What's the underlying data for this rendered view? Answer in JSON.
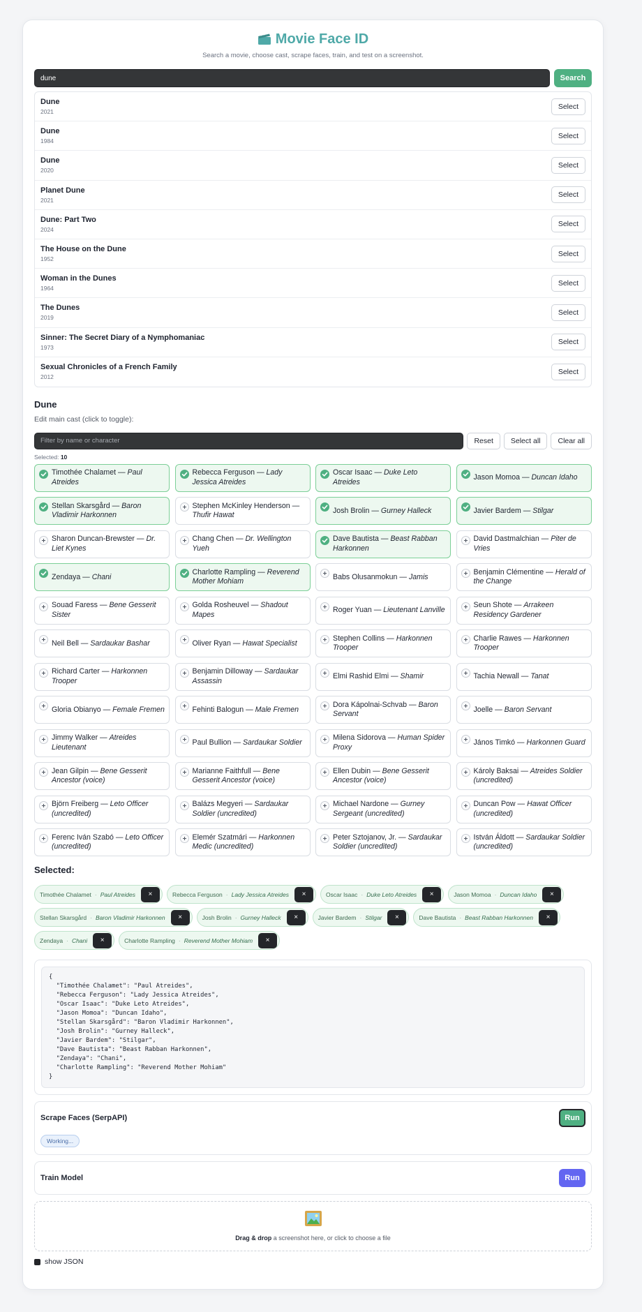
{
  "header": {
    "title": "Movie Face ID",
    "subtitle": "Search a movie, choose cast, scrape faces, train, and test on a screenshot."
  },
  "search": {
    "value": "dune",
    "button": "Search"
  },
  "results": [
    {
      "title": "Dune",
      "year": "2021"
    },
    {
      "title": "Dune",
      "year": "1984"
    },
    {
      "title": "Dune",
      "year": "2020"
    },
    {
      "title": "Planet Dune",
      "year": "2021"
    },
    {
      "title": "Dune: Part Two",
      "year": "2024"
    },
    {
      "title": "The House on the Dune",
      "year": "1952"
    },
    {
      "title": "Woman in the Dunes",
      "year": "1964"
    },
    {
      "title": "The Dunes",
      "year": "2019"
    },
    {
      "title": "Sinner: The Secret Diary of a Nymphomaniac",
      "year": "1973"
    },
    {
      "title": "Sexual Chronicles of a French Family",
      "year": "2012"
    }
  ],
  "select_label": "Select",
  "movie": {
    "title": "Dune",
    "edit_label": "Edit main cast (click to toggle):",
    "filter_placeholder": "Filter by name or character",
    "reset": "Reset",
    "select_all": "Select all",
    "clear_all": "Clear all",
    "selected_label": "Selected:",
    "selected_count": "10"
  },
  "cast": [
    {
      "actor": "Timothée Chalamet",
      "role": "Paul Atreides",
      "selected": true
    },
    {
      "actor": "Rebecca Ferguson",
      "role": "Lady Jessica Atreides",
      "selected": true
    },
    {
      "actor": "Oscar Isaac",
      "role": "Duke Leto Atreides",
      "selected": true
    },
    {
      "actor": "Jason Momoa",
      "role": "Duncan Idaho",
      "selected": true
    },
    {
      "actor": "Stellan Skarsgård",
      "role": "Baron Vladimir Harkonnen",
      "selected": true
    },
    {
      "actor": "Stephen McKinley Henderson",
      "role": "Thufir Hawat",
      "selected": false
    },
    {
      "actor": "Josh Brolin",
      "role": "Gurney Halleck",
      "selected": true
    },
    {
      "actor": "Javier Bardem",
      "role": "Stilgar",
      "selected": true
    },
    {
      "actor": "Sharon Duncan-Brewster",
      "role": "Dr. Liet Kynes",
      "selected": false
    },
    {
      "actor": "Chang Chen",
      "role": "Dr. Wellington Yueh",
      "selected": false
    },
    {
      "actor": "Dave Bautista",
      "role": "Beast Rabban Harkonnen",
      "selected": true
    },
    {
      "actor": "David Dastmalchian",
      "role": "Piter de Vries",
      "selected": false
    },
    {
      "actor": "Zendaya",
      "role": "Chani",
      "selected": true
    },
    {
      "actor": "Charlotte Rampling",
      "role": "Reverend Mother Mohiam",
      "selected": true
    },
    {
      "actor": "Babs Olusanmokun",
      "role": "Jamis",
      "selected": false
    },
    {
      "actor": "Benjamin Clémentine",
      "role": "Herald of the Change",
      "selected": false
    },
    {
      "actor": "Souad Faress",
      "role": "Bene Gesserit Sister",
      "selected": false
    },
    {
      "actor": "Golda Rosheuvel",
      "role": "Shadout Mapes",
      "selected": false
    },
    {
      "actor": "Roger Yuan",
      "role": "Lieutenant Lanville",
      "selected": false
    },
    {
      "actor": "Seun Shote",
      "role": "Arrakeen Residency Gardener",
      "selected": false
    },
    {
      "actor": "Neil Bell",
      "role": "Sardaukar Bashar",
      "selected": false
    },
    {
      "actor": "Oliver Ryan",
      "role": "Hawat Specialist",
      "selected": false
    },
    {
      "actor": "Stephen Collins",
      "role": "Harkonnen Trooper",
      "selected": false
    },
    {
      "actor": "Charlie Rawes",
      "role": "Harkonnen Trooper",
      "selected": false
    },
    {
      "actor": "Richard Carter",
      "role": "Harkonnen Trooper",
      "selected": false
    },
    {
      "actor": "Benjamin Dilloway",
      "role": "Sardaukar Assassin",
      "selected": false
    },
    {
      "actor": "Elmi Rashid Elmi",
      "role": "Shamir",
      "selected": false
    },
    {
      "actor": "Tachia Newall",
      "role": "Tanat",
      "selected": false
    },
    {
      "actor": "Gloria Obianyo",
      "role": "Female Fremen",
      "selected": false
    },
    {
      "actor": "Fehinti Balogun",
      "role": "Male Fremen",
      "selected": false
    },
    {
      "actor": "Dora Kápolnai-Schvab",
      "role": "Baron Servant",
      "selected": false
    },
    {
      "actor": "Joelle",
      "role": "Baron Servant",
      "selected": false
    },
    {
      "actor": "Jimmy Walker",
      "role": "Atreides Lieutenant",
      "selected": false
    },
    {
      "actor": "Paul Bullion",
      "role": "Sardaukar Soldier",
      "selected": false
    },
    {
      "actor": "Milena Sidorova",
      "role": "Human Spider Proxy",
      "selected": false
    },
    {
      "actor": "János Timkó",
      "role": "Harkonnen Guard",
      "selected": false
    },
    {
      "actor": "Jean Gilpin",
      "role": "Bene Gesserit Ancestor (voice)",
      "selected": false
    },
    {
      "actor": "Marianne Faithfull",
      "role": "Bene Gesserit Ancestor (voice)",
      "selected": false
    },
    {
      "actor": "Ellen Dubin",
      "role": "Bene Gesserit Ancestor (voice)",
      "selected": false
    },
    {
      "actor": "Károly Baksai",
      "role": "Atreides Soldier (uncredited)",
      "selected": false
    },
    {
      "actor": "Björn Freiberg",
      "role": "Leto Officer (uncredited)",
      "selected": false
    },
    {
      "actor": "Balázs Megyeri",
      "role": "Sardaukar Soldier (uncredited)",
      "selected": false
    },
    {
      "actor": "Michael Nardone",
      "role": "Gurney Sergeant (uncredited)",
      "selected": false
    },
    {
      "actor": "Duncan Pow",
      "role": "Hawat Officer (uncredited)",
      "selected": false
    },
    {
      "actor": "Ferenc Iván Szabó",
      "role": "Leto Officer (uncredited)",
      "selected": false
    },
    {
      "actor": "Elemér Szatmári",
      "role": "Harkonnen Medic (uncredited)",
      "selected": false
    },
    {
      "actor": "Peter Sztojanov, Jr.",
      "role": "Sardaukar Soldier (uncredited)",
      "selected": false
    },
    {
      "actor": "István Áldott",
      "role": "Sardaukar Soldier (uncredited)",
      "selected": false
    }
  ],
  "selected_section": {
    "title": "Selected:",
    "chips": [
      {
        "actor": "Timothée Chalamet",
        "role": "Paul Atreides"
      },
      {
        "actor": "Rebecca Ferguson",
        "role": "Lady Jessica Atreides"
      },
      {
        "actor": "Oscar Isaac",
        "role": "Duke Leto Atreides"
      },
      {
        "actor": "Jason Momoa",
        "role": "Duncan Idaho"
      },
      {
        "actor": "Stellan Skarsgård",
        "role": "Baron Vladimir Harkonnen"
      },
      {
        "actor": "Josh Brolin",
        "role": "Gurney Halleck"
      },
      {
        "actor": "Javier Bardem",
        "role": "Stilgar"
      },
      {
        "actor": "Dave Bautista",
        "role": "Beast Rabban Harkonnen"
      },
      {
        "actor": "Zendaya",
        "role": "Chani"
      },
      {
        "actor": "Charlotte Rampling",
        "role": "Reverend Mother Mohiam"
      }
    ],
    "remove_label": "×"
  },
  "json_preview": "{\n  \"Timothée Chalamet\": \"Paul Atreides\",\n  \"Rebecca Ferguson\": \"Lady Jessica Atreides\",\n  \"Oscar Isaac\": \"Duke Leto Atreides\",\n  \"Jason Momoa\": \"Duncan Idaho\",\n  \"Stellan Skarsgård\": \"Baron Vladimir Harkonnen\",\n  \"Josh Brolin\": \"Gurney Halleck\",\n  \"Javier Bardem\": \"Stilgar\",\n  \"Dave Bautista\": \"Beast Rabban Harkonnen\",\n  \"Zendaya\": \"Chani\",\n  \"Charlotte Rampling\": \"Reverend Mother Mohiam\"\n}",
  "scrape": {
    "title": "Scrape Faces (SerpAPI)",
    "run": "Run",
    "status": "Working..."
  },
  "train": {
    "title": "Train Model",
    "run": "Run"
  },
  "dropzone": {
    "bold": "Drag & drop",
    "rest": " a screenshot here, or click to choose a file"
  },
  "show_json": {
    "label": "show JSON"
  },
  "colors": {
    "accent_teal": "#4fa9a8",
    "green": "#4fb082",
    "indigo": "#6366f1"
  }
}
